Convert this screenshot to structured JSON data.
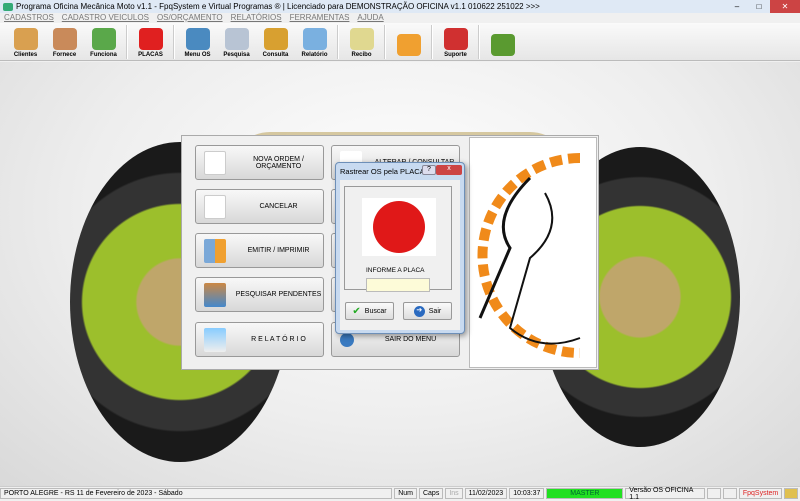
{
  "window": {
    "title": "Programa Oficina Mecânica Moto v1.1 - FpqSystem e Virtual Programas ® | Licenciado para  DEMONSTRAÇÃO OFICINA v1.1 010622 251022 >>>",
    "minimize": "–",
    "maximize": "□",
    "close": "✕"
  },
  "menu": [
    "CADASTROS",
    "CADASTRO VEICULOS",
    "OS/ORÇAMENTO",
    "RELATÓRIOS",
    "FERRAMENTAS",
    "AJUDA"
  ],
  "toolbar": [
    {
      "label": "Clientes",
      "color": "#d9a050"
    },
    {
      "label": "Fornece",
      "color": "#c98a5a"
    },
    {
      "label": "Funciona",
      "color": "#5aa84a"
    },
    {
      "label": "PLACAS",
      "color": "#e02020"
    },
    {
      "label": "Menu OS",
      "color": "#4a8ac0"
    },
    {
      "label": "Pesquisa",
      "color": "#b8c4d4"
    },
    {
      "label": "Consulta",
      "color": "#d8a030"
    },
    {
      "label": "Relatório",
      "color": "#7ab0e0"
    },
    {
      "label": "Recibo",
      "color": "#e0d890"
    },
    {
      "label": "",
      "color": "#f0a030"
    },
    {
      "label": "Suporte",
      "color": "#d03030"
    },
    {
      "label": "",
      "color": "#5a9a30"
    }
  ],
  "menu_panel": {
    "left_buttons": [
      "NOVA ORDEM / ORÇAMENTO",
      "CANCELAR",
      "EMITIR  /  IMPRIMIR",
      "PESQUISAR PENDENTES",
      "R E L A T Ó R I O"
    ],
    "right_buttons": [
      "ALTERAR  /  CONSULTAR",
      "SAIR DO MENU"
    ]
  },
  "dialog": {
    "title": "Rastrear OS pela PLACA",
    "help": "?",
    "close": "x",
    "field_label": "INFORME A PLACA",
    "plate_value": "",
    "search_button": "Buscar",
    "exit_button": "Sair"
  },
  "status": {
    "location": "PORTO ALEGRE - RS 11 de Fevereiro de 2023 - Sábado",
    "num": "Num",
    "caps": "Caps",
    "ins": "Ins",
    "date": "11/02/2023",
    "time": "10:03:37",
    "user": "MASTER",
    "version": "Versão OS OFICINA 1.1",
    "brand": "FpqSystem"
  }
}
